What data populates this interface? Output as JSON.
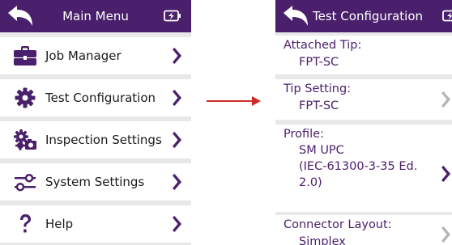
{
  "main_menu": {
    "title": "Main Menu",
    "items": [
      {
        "label": "Job Manager",
        "icon": "briefcase-icon"
      },
      {
        "label": "Test Configuration",
        "icon": "gear-icon"
      },
      {
        "label": "Inspection Settings",
        "icon": "gears-camera-icon"
      },
      {
        "label": "System Settings",
        "icon": "sliders-icon"
      },
      {
        "label": "Help",
        "icon": "question-mark-icon"
      }
    ]
  },
  "test_config": {
    "title": "Test Configuration",
    "rows": [
      {
        "label": "Attached Tip:",
        "value": [
          "FPT-SC"
        ]
      },
      {
        "label": "Tip Setting:",
        "value": [
          "FPT-SC"
        ]
      },
      {
        "label": "Profile:",
        "value": [
          "SM UPC",
          "(IEC-61300-3-35 Ed.",
          "2.0)"
        ]
      },
      {
        "label": "Connector Layout:",
        "value": [
          "Simplex"
        ]
      }
    ]
  },
  "colors": {
    "header": "#4a1f6b",
    "text_accent": "#4a1f6b",
    "chevron_active": "#4a1f6b",
    "chevron_disabled": "#b5b5b5",
    "arrow": "#cf2a2a",
    "background": "#e8e8e8"
  }
}
